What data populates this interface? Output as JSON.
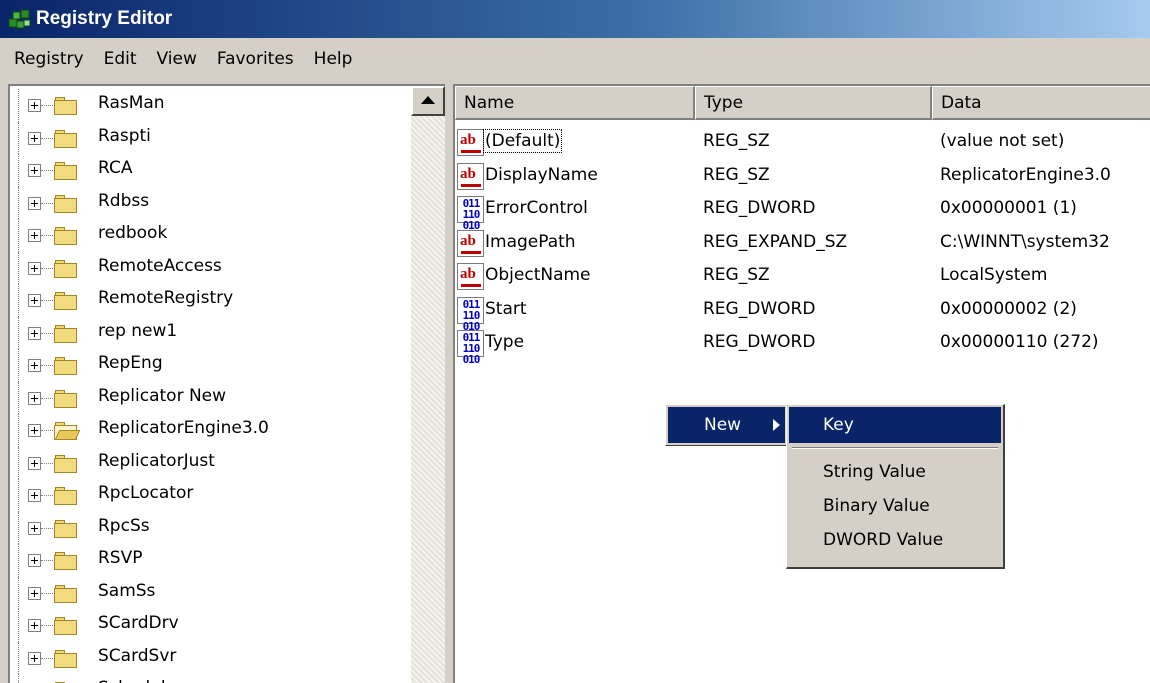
{
  "window": {
    "title": "Registry Editor",
    "icon": "registry-editor-icon"
  },
  "menubar": {
    "items": [
      "Registry",
      "Edit",
      "View",
      "Favorites",
      "Help"
    ]
  },
  "tree": {
    "items": [
      {
        "label": "RasMan",
        "icon": "folder-closed-icon"
      },
      {
        "label": "Raspti",
        "icon": "folder-closed-icon"
      },
      {
        "label": "RCA",
        "icon": "folder-closed-icon"
      },
      {
        "label": "Rdbss",
        "icon": "folder-closed-icon"
      },
      {
        "label": "redbook",
        "icon": "folder-closed-icon"
      },
      {
        "label": "RemoteAccess",
        "icon": "folder-closed-icon"
      },
      {
        "label": "RemoteRegistry",
        "icon": "folder-closed-icon"
      },
      {
        "label": "rep new1",
        "icon": "folder-closed-icon"
      },
      {
        "label": "RepEng",
        "icon": "folder-closed-icon"
      },
      {
        "label": "Replicator New",
        "icon": "folder-closed-icon"
      },
      {
        "label": "ReplicatorEngine3.0",
        "icon": "folder-open-icon",
        "selected": true
      },
      {
        "label": "ReplicatorJust",
        "icon": "folder-closed-icon"
      },
      {
        "label": "RpcLocator",
        "icon": "folder-closed-icon"
      },
      {
        "label": "RpcSs",
        "icon": "folder-closed-icon"
      },
      {
        "label": "RSVP",
        "icon": "folder-closed-icon"
      },
      {
        "label": "SamSs",
        "icon": "folder-closed-icon"
      },
      {
        "label": "SCardDrv",
        "icon": "folder-closed-icon"
      },
      {
        "label": "SCardSvr",
        "icon": "folder-closed-icon"
      },
      {
        "label": "Schedule",
        "icon": "folder-closed-icon"
      }
    ]
  },
  "list": {
    "columns": {
      "name": "Name",
      "type": "Type",
      "data": "Data"
    },
    "rows": [
      {
        "name": "(Default)",
        "type": "REG_SZ",
        "data": "(value not set)",
        "icon": "string-value-icon"
      },
      {
        "name": "DisplayName",
        "type": "REG_SZ",
        "data": "ReplicatorEngine3.0",
        "icon": "string-value-icon"
      },
      {
        "name": "ErrorControl",
        "type": "REG_DWORD",
        "data": "0x00000001 (1)",
        "icon": "binary-value-icon"
      },
      {
        "name": "ImagePath",
        "type": "REG_EXPAND_SZ",
        "data": "C:\\WINNT\\system32",
        "icon": "string-value-icon"
      },
      {
        "name": "ObjectName",
        "type": "REG_SZ",
        "data": "LocalSystem",
        "icon": "string-value-icon"
      },
      {
        "name": "Start",
        "type": "REG_DWORD",
        "data": "0x00000002 (2)",
        "icon": "binary-value-icon"
      },
      {
        "name": "Type",
        "type": "REG_DWORD",
        "data": "0x00000110 (272)",
        "icon": "binary-value-icon"
      }
    ]
  },
  "context_menu": {
    "new_label": "New",
    "submenu": [
      "Key",
      "String Value",
      "Binary Value",
      "DWORD Value"
    ]
  },
  "colors": {
    "title_gradient_start": "#0a246a",
    "title_gradient_end": "#a6caf0",
    "highlight": "#0a246a",
    "face": "#d4d0c8"
  }
}
